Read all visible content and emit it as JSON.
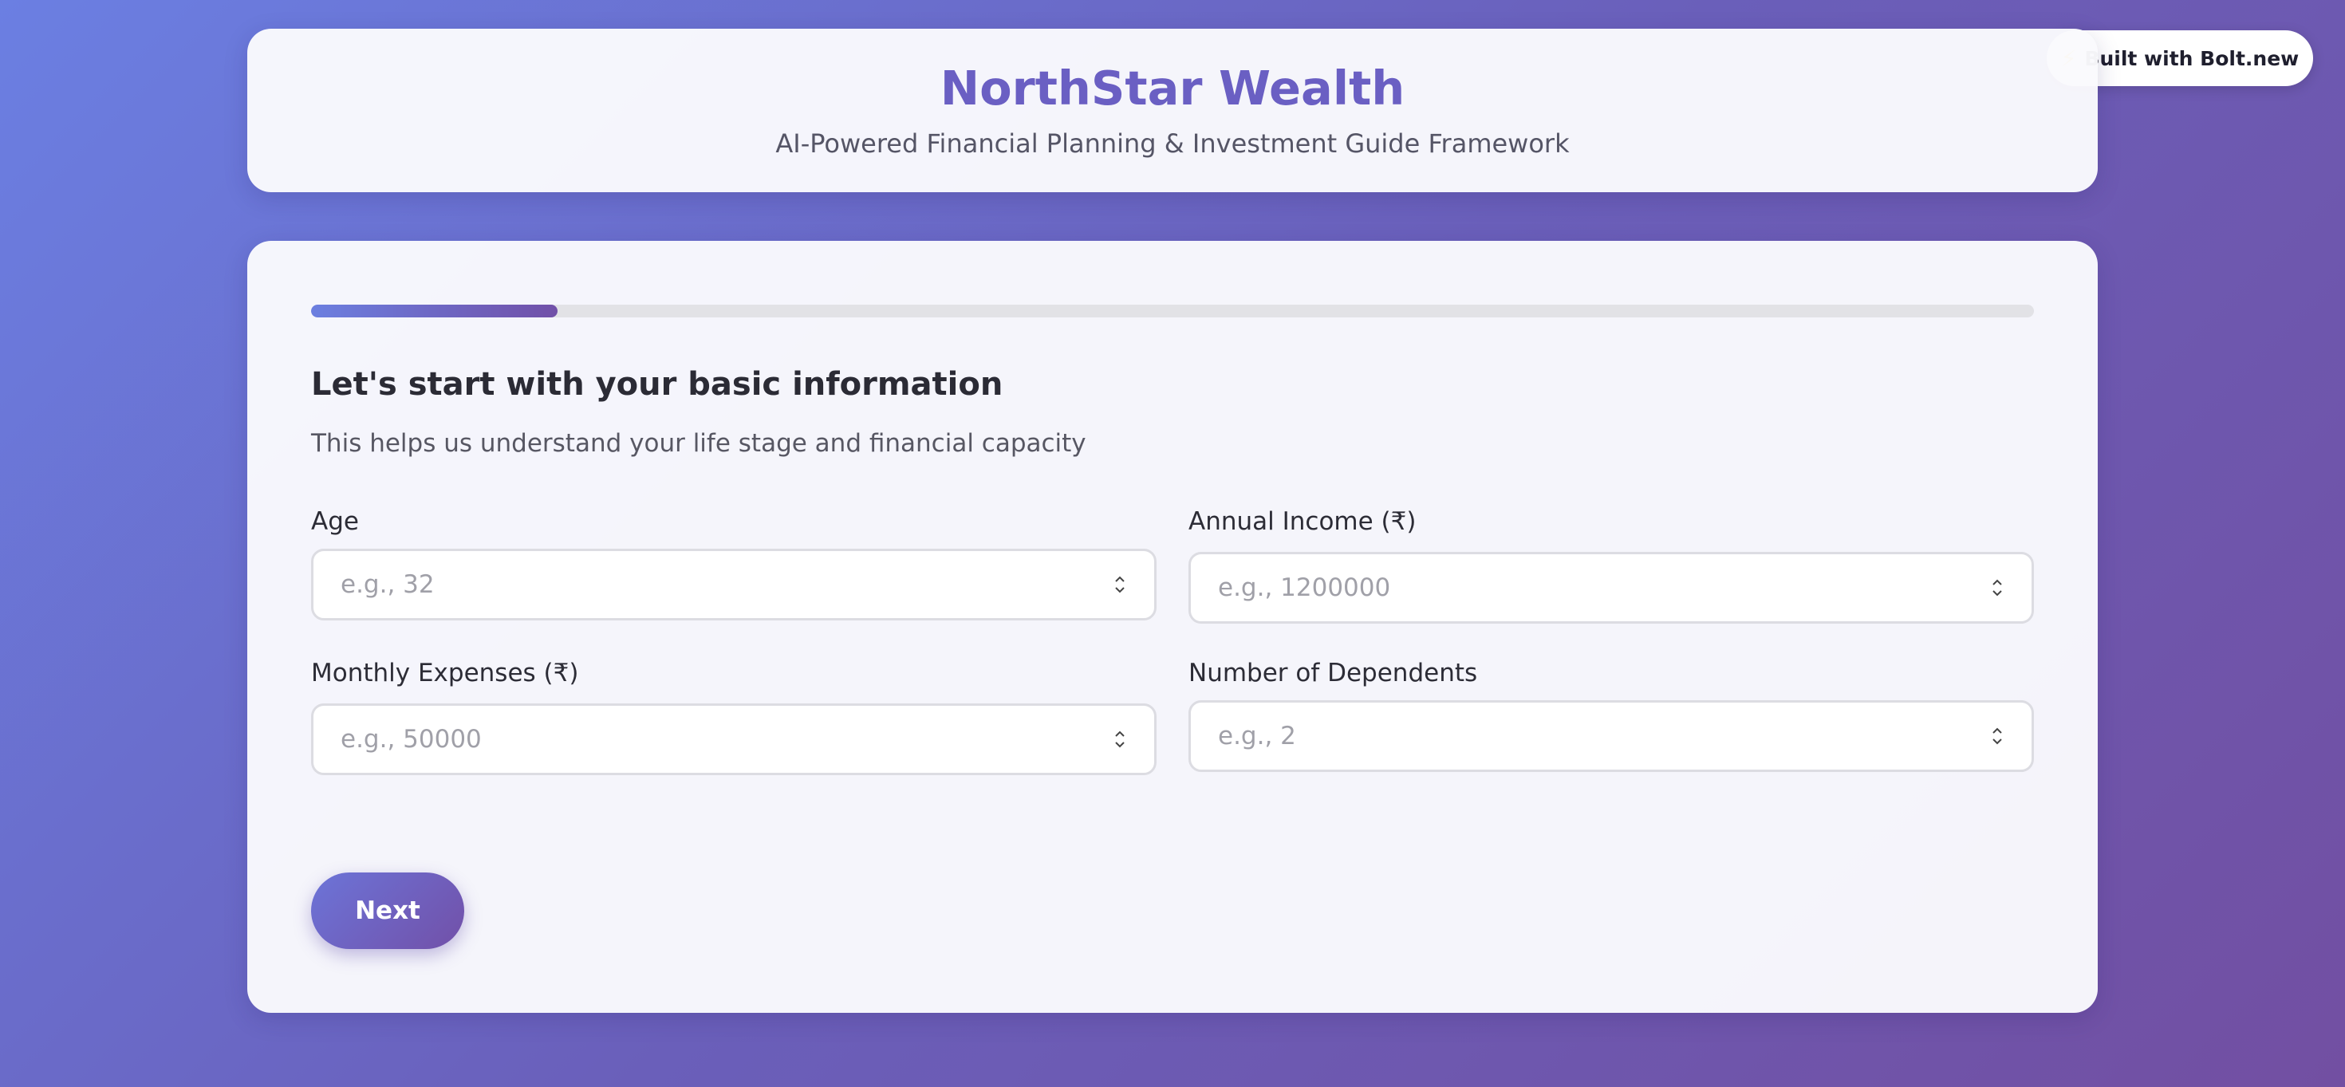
{
  "badge": {
    "icon": "lightning-bolt-icon",
    "label": "Built with Bolt.new"
  },
  "header": {
    "title": "NorthStar Wealth",
    "subtitle": "AI-Powered Financial Planning & Investment Guide Framework"
  },
  "progress": {
    "fraction": 0.143
  },
  "section": {
    "title": "Let's start with your basic information",
    "subtitle": "This helps us understand your life stage and financial capacity"
  },
  "fields": [
    {
      "label": "Age",
      "placeholder": "e.g., 32"
    },
    {
      "label": "Annual Income (₹)",
      "placeholder": "e.g., 1200000"
    },
    {
      "label": "Monthly Expenses (₹)",
      "placeholder": "e.g., 50000"
    },
    {
      "label": "Number of Dependents",
      "placeholder": "e.g., 2"
    }
  ],
  "actions": {
    "next_label": "Next"
  },
  "colors": {
    "accent": "#6a5fc3",
    "gradient_start": "#6b7fe2",
    "gradient_end": "#724fa2"
  }
}
